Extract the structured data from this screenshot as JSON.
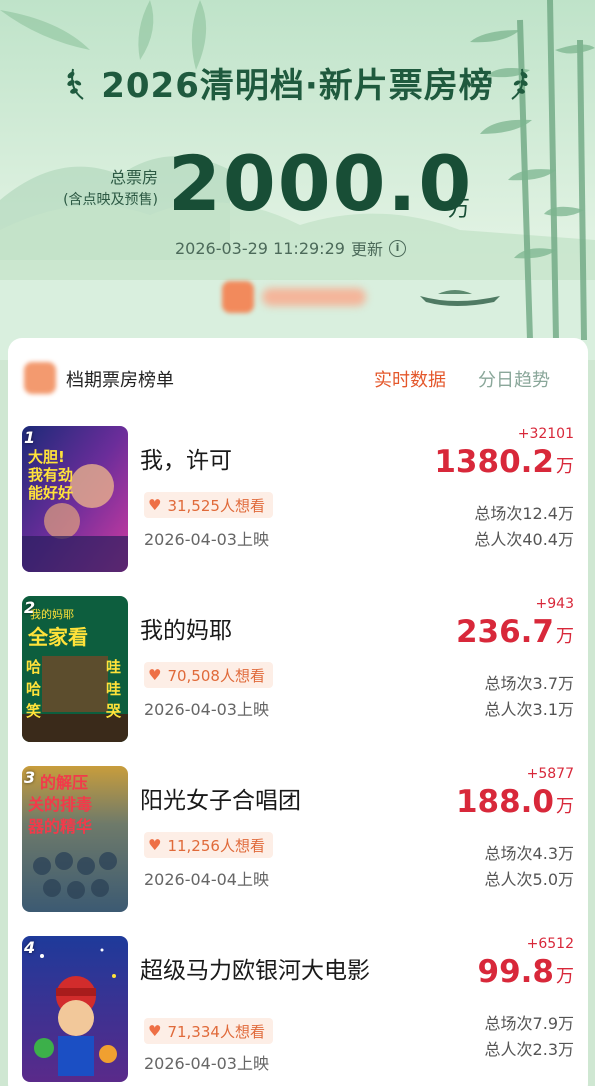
{
  "header": {
    "title": "2026清明档·新片票房榜",
    "total_label": "总票房",
    "total_sublabel": "(含点映及预售)",
    "total_value": "2000.0",
    "total_unit": "万",
    "updated_time": "2026-03-29 11:29:29",
    "updated_suffix": "更新",
    "info_icon_glyph": "i"
  },
  "board": {
    "title": "档期票房榜单",
    "tabs": [
      {
        "label": "实时数据",
        "active": true
      },
      {
        "label": "分日趋势",
        "active": false
      }
    ]
  },
  "movies": [
    {
      "rank": "1",
      "title": "我，许可",
      "delta": "+32101",
      "box_office": "1380.2",
      "unit": "万",
      "want": "31,525人想看",
      "release": "2026-04-03上映",
      "total_shows": "总场次12.4万",
      "total_viewers": "总人次40.4万",
      "poster_text": "大胆!\n我有劲\n能好好",
      "poster_colors": [
        "#1c2a78",
        "#d13ca0"
      ]
    },
    {
      "rank": "2",
      "title": "我的妈耶",
      "delta": "+943",
      "box_office": "236.7",
      "unit": "万",
      "want": "70,508人想看",
      "release": "2026-04-03上映",
      "total_shows": "总场次3.7万",
      "total_viewers": "总人次3.1万",
      "poster_text": "全家看\n哈 哇\n哈 哇\n笑 哭",
      "poster_colors": [
        "#0d5e3e",
        "#3a2a1a"
      ]
    },
    {
      "rank": "3",
      "title": "阳光女子合唱团",
      "delta": "+5877",
      "box_office": "188.0",
      "unit": "万",
      "want": "11,256人想看",
      "release": "2026-04-04上映",
      "total_shows": "总场次4.3万",
      "total_viewers": "总人次5.0万",
      "poster_text": "的解压\n关的排毒\n器的精华",
      "poster_colors": [
        "#3c5a72",
        "#c89d3c"
      ]
    },
    {
      "rank": "4",
      "title": "超级马力欧银河大电影",
      "delta": "+6512",
      "box_office": "99.8",
      "unit": "万",
      "want": "71,334人想看",
      "release": "2026-04-03上映",
      "total_shows": "总场次7.9万",
      "total_viewers": "总人次2.3万",
      "poster_text": "",
      "poster_colors": [
        "#1e3a9a",
        "#d22c2c"
      ]
    }
  ],
  "icons": {
    "heart": "heart-icon",
    "info": "info-icon",
    "laurel": "laurel-icon"
  },
  "colors": {
    "accent_red": "#d8283a",
    "active_tab": "#e4582c",
    "title_green": "#1f5a3e"
  }
}
